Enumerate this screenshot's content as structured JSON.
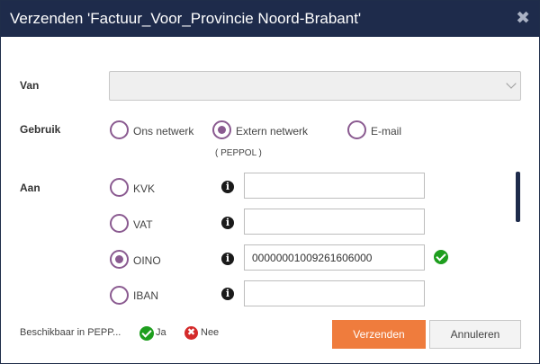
{
  "dialog": {
    "title": "Verzenden 'Factuur_Voor_Provincie Noord-Brabant'",
    "close_symbol": "✖"
  },
  "form": {
    "van": {
      "label": "Van",
      "value": ""
    },
    "gebruik": {
      "label": "Gebruik",
      "options": [
        {
          "label": "Ons netwerk",
          "selected": false
        },
        {
          "label": "Extern netwerk",
          "sublabel": "( PEPPOL )",
          "selected": true
        },
        {
          "label": "E-mail",
          "selected": false
        }
      ]
    },
    "aan": {
      "label": "Aan",
      "info_symbol": "i",
      "rows": [
        {
          "label": "KVK",
          "selected": false,
          "value": ""
        },
        {
          "label": "VAT",
          "selected": false,
          "value": ""
        },
        {
          "label": "OINO",
          "selected": true,
          "value": "00000001009261606000",
          "valid": true
        },
        {
          "label": "IBAN",
          "selected": false,
          "value": ""
        }
      ]
    }
  },
  "footer": {
    "availability_label": "Beschikbaar in PEPP...",
    "yes_label": "Ja",
    "no_label": "Nee",
    "no_symbol": "✖",
    "send_label": "Verzenden",
    "cancel_label": "Annuleren"
  },
  "colors": {
    "titlebar": "#1e2b4b",
    "radio": "#8a5a90",
    "primary_button": "#ef7c3d",
    "valid": "#1e9e1e",
    "invalid": "#d42a2a"
  },
  "icons": {
    "close": "close-icon",
    "dropdown": "chevron-down-icon",
    "info": "info-icon",
    "valid": "check-circle-icon",
    "invalid": "x-circle-icon"
  }
}
